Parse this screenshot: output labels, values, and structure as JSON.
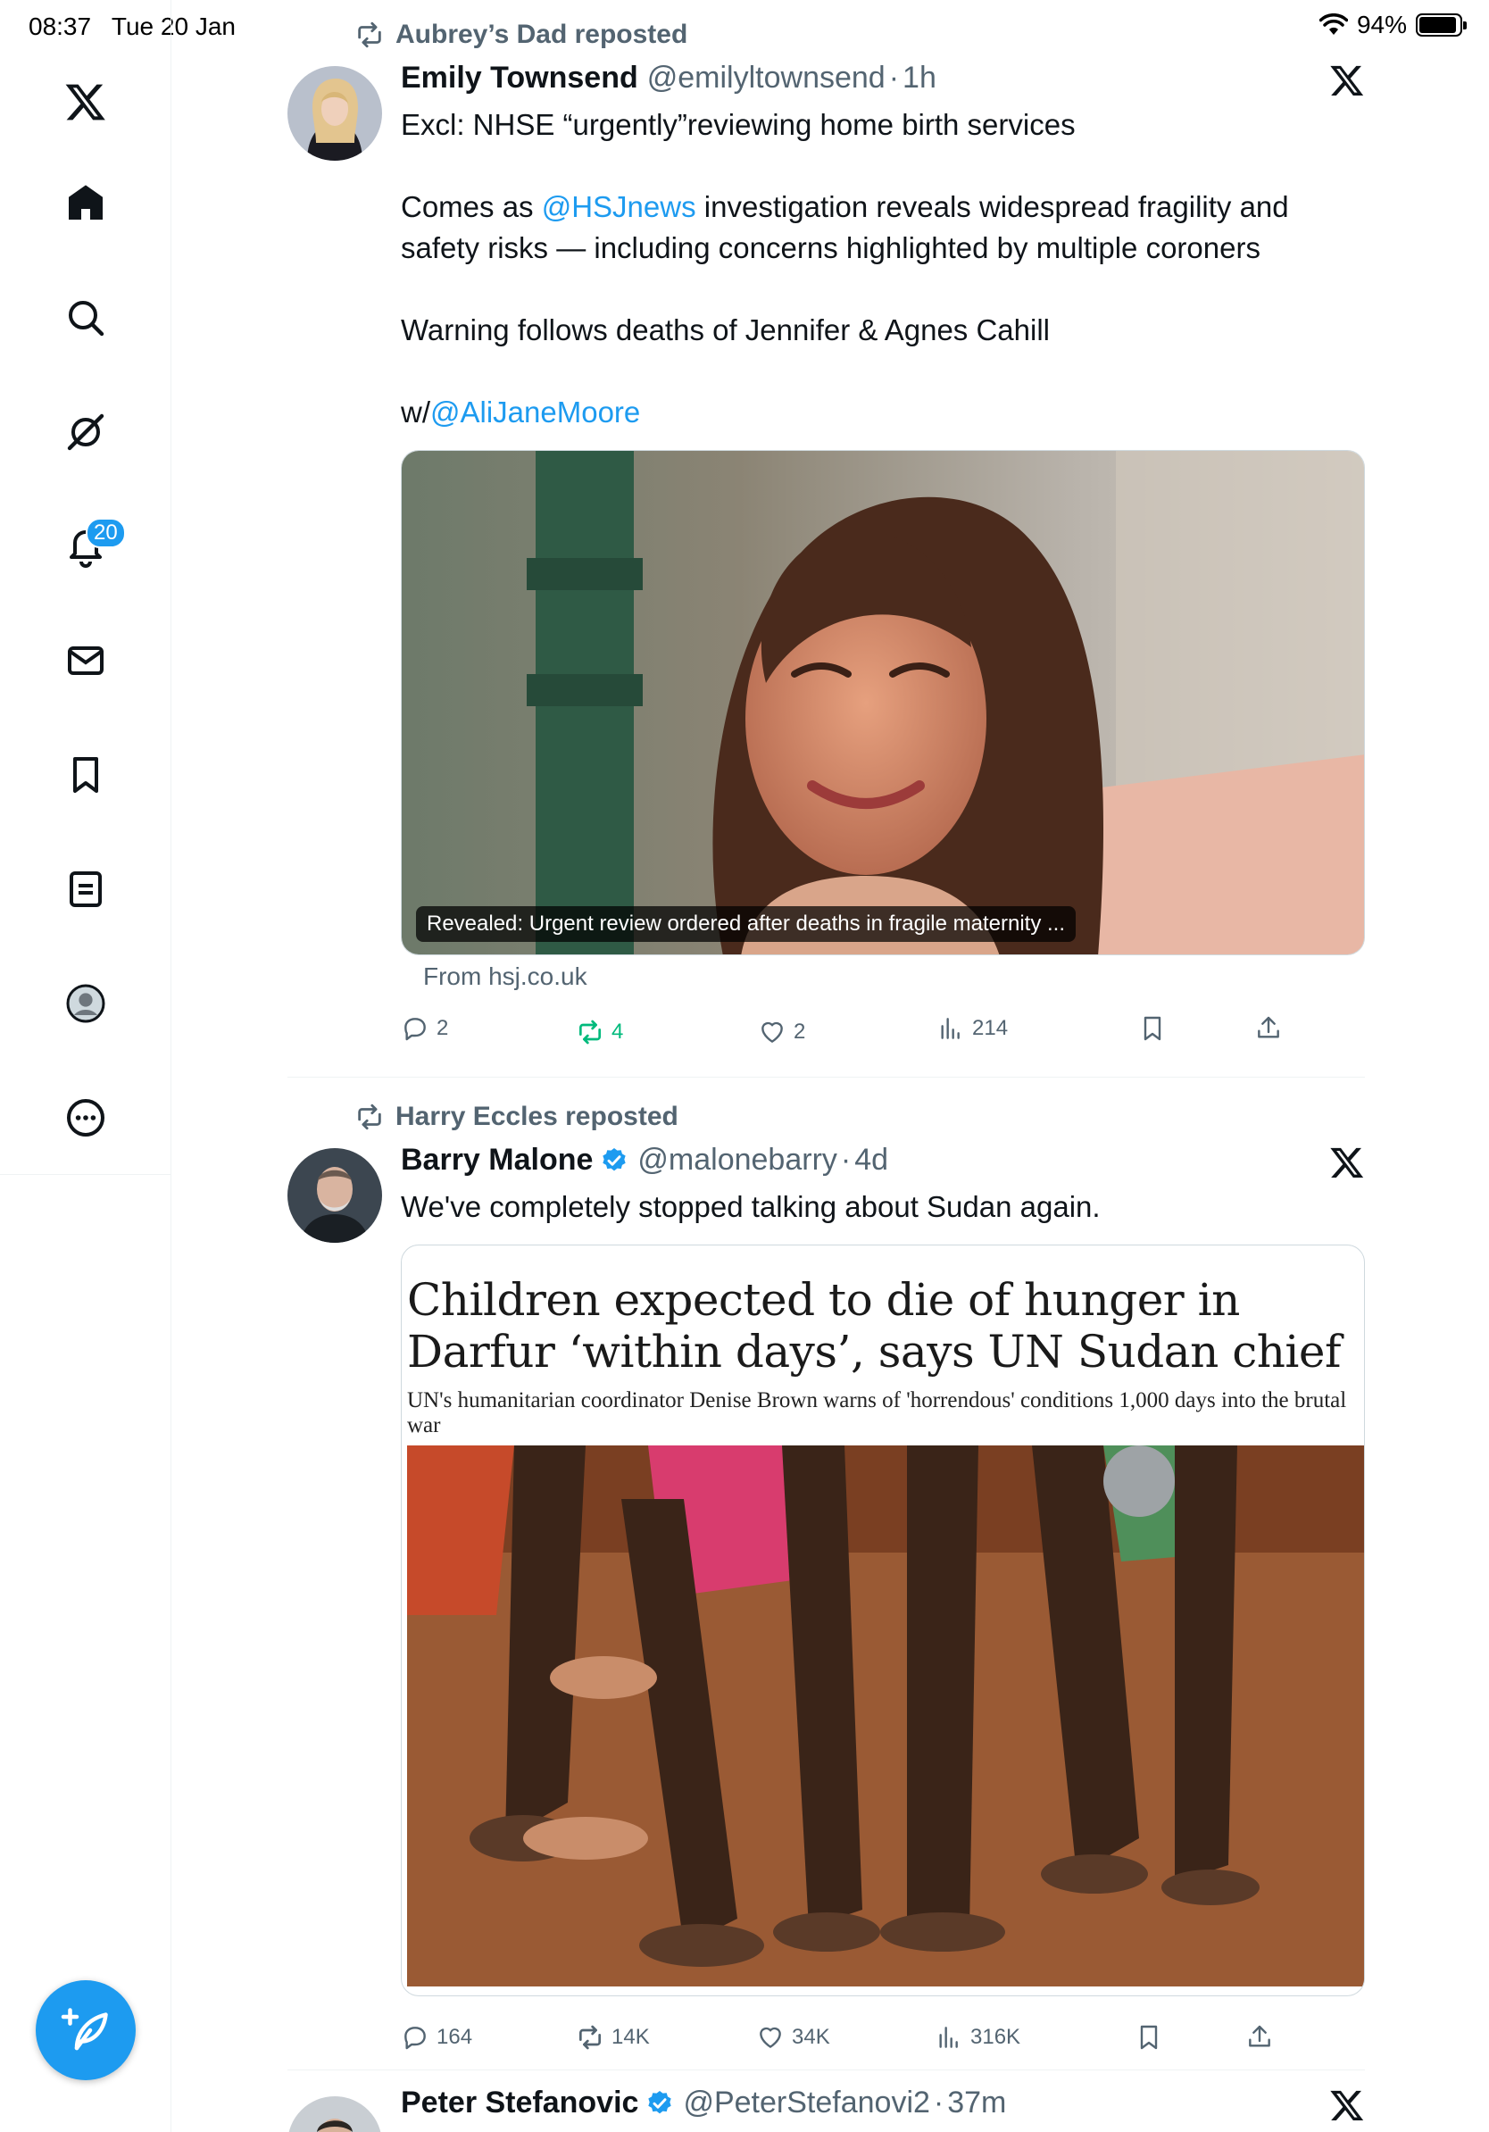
{
  "status_bar": {
    "time": "08:37",
    "date": "Tue 20 Jan",
    "battery": "94%",
    "battery_level": 0.94
  },
  "sidebar": {
    "items": [
      {
        "name": "x-logo",
        "icon": "x-logo-icon"
      },
      {
        "name": "home",
        "icon": "home-icon"
      },
      {
        "name": "search",
        "icon": "search-icon"
      },
      {
        "name": "grok",
        "icon": "grok-icon"
      },
      {
        "name": "notifications",
        "icon": "bell-icon",
        "badge": "20"
      },
      {
        "name": "messages",
        "icon": "envelope-icon"
      },
      {
        "name": "bookmarks",
        "icon": "bookmark-icon"
      },
      {
        "name": "lists",
        "icon": "list-icon"
      },
      {
        "name": "profile",
        "icon": "avatar-icon"
      },
      {
        "name": "more",
        "icon": "more-icon"
      }
    ],
    "compose_icon": "compose-icon"
  },
  "posts": [
    {
      "repost_by": "Aubrey’s Dad reposted",
      "name": "Emily Townsend",
      "handle": "@emilyltownsend",
      "sep": "·",
      "time": "1h",
      "verified": false,
      "text": {
        "l1": "Excl: NHSE “urgently”reviewing home birth services",
        "l2a": "Comes as ",
        "l2m": "@HSJnews",
        "l2b": " investigation reveals widespread fragility and safety risks — including concerns highlighted by multiple coroners",
        "l3": "Warning follows deaths of Jennifer & Agnes Cahill",
        "l4a": "w/",
        "l4m": "@AliJaneMoore"
      },
      "media_caption": "Revealed: Urgent review ordered after deaths in fragile maternity ...",
      "from": "From hsj.co.uk",
      "actions": {
        "replies": "2",
        "reposts": "4",
        "likes": "2",
        "views": "214"
      }
    },
    {
      "repost_by": "Harry Eccles reposted",
      "name": "Barry Malone",
      "handle": "@malonebarry",
      "sep": "·",
      "time": "4d",
      "verified": true,
      "text": {
        "l1": "We've completely stopped talking about Sudan again."
      },
      "article": {
        "title": "Children expected to die of hunger in Darfur ‘within days’, says UN Sudan chief",
        "subtitle": "UN's humanitarian coordinator Denise Brown warns of 'horrendous' conditions 1,000 days into the brutal war"
      },
      "actions": {
        "replies": "164",
        "reposts": "14K",
        "likes": "34K",
        "views": "316K"
      }
    },
    {
      "name": "Peter Stefanovic",
      "handle": "@PeterStefanovi2",
      "sep": "·",
      "time": "37m",
      "verified": true
    }
  ],
  "colors": {
    "accent": "#1d9bf0",
    "muted": "#536471",
    "repost_active": "#00ba7c",
    "text": "#0f1419"
  }
}
